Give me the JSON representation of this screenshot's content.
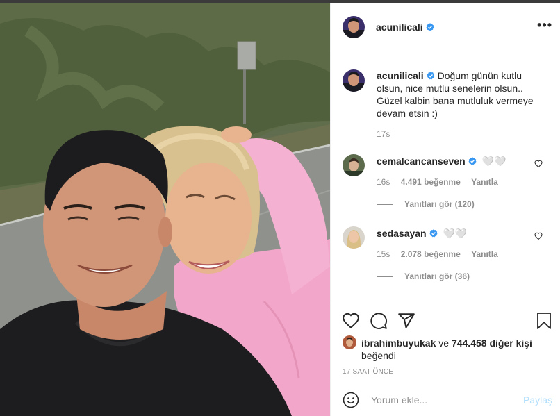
{
  "post": {
    "username": "acunilicali",
    "more_label": "•••"
  },
  "caption": {
    "username": "acunilicali",
    "text": "Doğum günün kutlu olsun, nice mutlu senelerin olsun.. Güzel kalbin bana mutluluk vermeye devam etsin :)",
    "time": "17s"
  },
  "comments": [
    {
      "username": "cemalcancanseven",
      "text": "🤍🤍",
      "time": "16s",
      "likes": "4.491 beğenme",
      "reply": "Yanıtla",
      "view_replies": "Yanıtları gör (120)"
    },
    {
      "username": "sedasayan",
      "text": "🤍🤍",
      "time": "15s",
      "likes": "2.078 beğenme",
      "reply": "Yanıtla",
      "view_replies": "Yanıtları gör (36)"
    }
  ],
  "likes": {
    "user": "ibrahimbuyukak",
    "connector": "ve",
    "others": "744.458 diğer kişi",
    "suffix": "beğendi"
  },
  "time_ago": "17 SAAT ÖNCE",
  "add_comment": {
    "placeholder": "Yorum ekle...",
    "share_label": "Paylaş"
  },
  "colors": {
    "verified": "#3897f0",
    "text": "#262626",
    "muted": "#8e8e8e",
    "share_disabled": "#b2dffc"
  },
  "icons": [
    "more-options-icon",
    "verified-badge-icon",
    "heart-icon",
    "comment-icon",
    "share-icon",
    "bookmark-icon",
    "emoji-icon"
  ]
}
